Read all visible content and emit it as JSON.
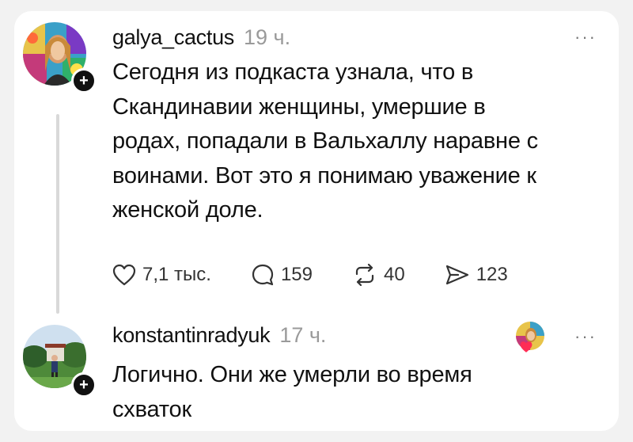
{
  "post": {
    "username": "galya_cactus",
    "time": "19 ч.",
    "text_lines": [
      "Сегодня из подкаста узнала, что в",
      "Скандинавии женщины, умершие в",
      "родах, попадали в Вальхаллу наравне с",
      "воинами. Вот это я понимаю уважение к",
      "женской доле."
    ],
    "likes": "7,1 тыс.",
    "comments": "159",
    "reposts": "40",
    "shares": "123"
  },
  "reply": {
    "username": "konstantinradyuk",
    "time": "17 ч.",
    "text_lines": [
      "Логично. Они же умерли во время",
      "схваток"
    ]
  },
  "more_label": "···",
  "follow_symbol": "+",
  "icons": [
    "heart-icon",
    "comment-icon",
    "repost-icon",
    "share-icon",
    "more-icon",
    "follow-plus-icon"
  ]
}
